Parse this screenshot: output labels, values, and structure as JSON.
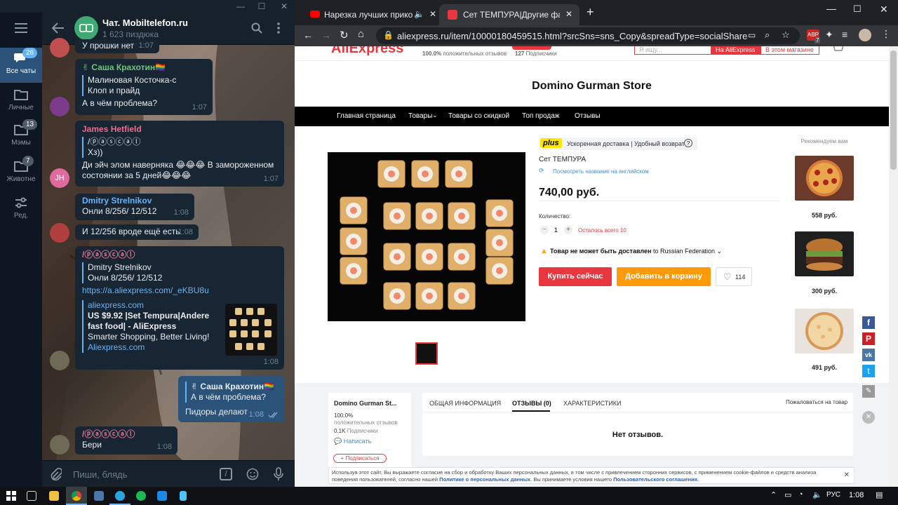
{
  "telegram": {
    "chat_title": "Чат. Mobiltelefon.ru",
    "chat_subtitle": "1 623 пиздюка",
    "folders": [
      {
        "label": "Все чаты",
        "badge": "26"
      },
      {
        "label": "Личные",
        "badge": ""
      },
      {
        "label": "Мэмы",
        "badge": "13"
      },
      {
        "label": "Животне",
        "badge": "7"
      },
      {
        "label": "Ред.",
        "badge": ""
      }
    ],
    "messages": [
      {
        "text": "У прошки нет",
        "time": "1:07"
      },
      {
        "sender": "✌ Саша Крахотин🏳️‍🌈",
        "reply_name": "Малиновая Косточка-с",
        "reply_text": "Клоп и прайд",
        "text": "А в чём проблема?",
        "time": "1:07"
      },
      {
        "sender": "James Hetfield",
        "reply_name": "/ⓟⓐⓢⓒⓐⓛ",
        "reply_text": "Хз))",
        "text": "Ди эйч элом наверняка 😂😂😂 В замороженном состоянии за 5 дней😂😂😂",
        "time": "1:07",
        "avatar": "JH"
      },
      {
        "sender": "Dmitry Strelnikov",
        "text": "Онли 8/256/ 12/512",
        "time": "1:08"
      },
      {
        "text": "И 12/256 вроде ещё есть",
        "time": "1:08"
      },
      {
        "sender": "/ⓟⓐⓢⓒⓐⓛ",
        "reply_name": "Dmitry Strelnikov",
        "reply_text": "Онли 8/256/ 12/512",
        "link": "https://a.aliexpress.com/_eKBU8u",
        "preview_site": "aliexpress.com",
        "preview_title": "US $9.92 |Set Tempura|Andere fast food|  - AliExpress",
        "preview_desc": "Smarter Shopping, Better Living!",
        "preview_domain": "Aliexpress.com",
        "time": "1:08"
      },
      {
        "sender": "✌ Саша Крахотин🏳️‍🌈",
        "text_line2": "А в чём проблема?",
        "text": "Пидоры делают",
        "time": "1:08"
      },
      {
        "sender": "/ⓟⓐⓢⓒⓐⓛ",
        "text": "Бери",
        "time": "1:08"
      }
    ],
    "input_placeholder": "Пиши, блядь"
  },
  "chrome": {
    "tabs": [
      {
        "title": "Нарезка лучших приколов"
      },
      {
        "title": "Сет ТЕМПУРА|Другие фаст-фуд"
      }
    ],
    "url": "aliexpress.ru/item/10000180459515.html?srcSns=sns_Copy&spreadType=socialShare&bizTy...",
    "ext_badge": "7"
  },
  "page": {
    "logo": "AliExpress",
    "top_rating": "100.0%",
    "top_rating_label": "положительных отзывов",
    "top_subs": "127",
    "top_subs_label": "Подписчики",
    "search_placeholder": "Я ищу...",
    "search_btn1": "На AliExpress",
    "search_btn2": "В этом магазине",
    "store_name": "Domino Gurman Store",
    "nav": [
      "Главная страница",
      "Товары",
      "Товары со скидкой",
      "Топ продаж",
      "Отзывы"
    ],
    "plus_badge": "plus",
    "plus_text": "Ускоренная доставка | Удобный возврат",
    "product_title": "Сет ТЕМПУРА",
    "translate_link": "Посмотреть название на английском",
    "price": "740,00 руб.",
    "qty_label": "Количество:",
    "qty_value": "1",
    "qty_left": "Осталось всего 10",
    "ship_warning_bold": "Товар не может быть доставлен",
    "ship_warning_rest": "to Russian Federation",
    "buy_btn": "Купить сейчас",
    "cart_btn": "Добавить в корзину",
    "wish_count": "114",
    "recommend_title": "Рекомендуем вам",
    "recommend": [
      {
        "price": "558 руб."
      },
      {
        "price": "300 руб."
      },
      {
        "price": "491 руб."
      }
    ],
    "seller_card": {
      "name": "Domino Gurman St...",
      "rating": "100.0%",
      "rating_label": "положительных отзывов",
      "subs": "0.1K",
      "subs_label": "Подписчики",
      "write": "Написать",
      "subscribe": "+ Подписаться"
    },
    "tabs": [
      "ОБЩАЯ ИНФОРМАЦИЯ",
      "ОТЗЫВЫ (0)",
      "ХАРАКТЕРИСТИКИ"
    ],
    "complain": "Пожаловаться на товар",
    "no_reviews": "Нет отзывов.",
    "cookie_text_1": "Используя этот сайт, Вы выражаете согласие на сбор и обработку Ваших персональных данных, в том числе с привлечением сторонних сервисов, с применением cookie-файлов и средств анализа поведения пользователей, согласно нашей ",
    "cookie_link_1": "Политике о персональных данных",
    "cookie_text_2": ". Вы принимаете условия нашего ",
    "cookie_link_2": "Пользовательского соглашения",
    "cookie_text_3": "."
  },
  "taskbar": {
    "lang": "РУС",
    "time": "1:08"
  },
  "colors": {
    "tg_bg": "#17212b",
    "tg_accent": "#6ab3f3",
    "ali_red": "#e8373f",
    "ali_orange": "#fd9a0a",
    "nav_bg": "#000000"
  }
}
